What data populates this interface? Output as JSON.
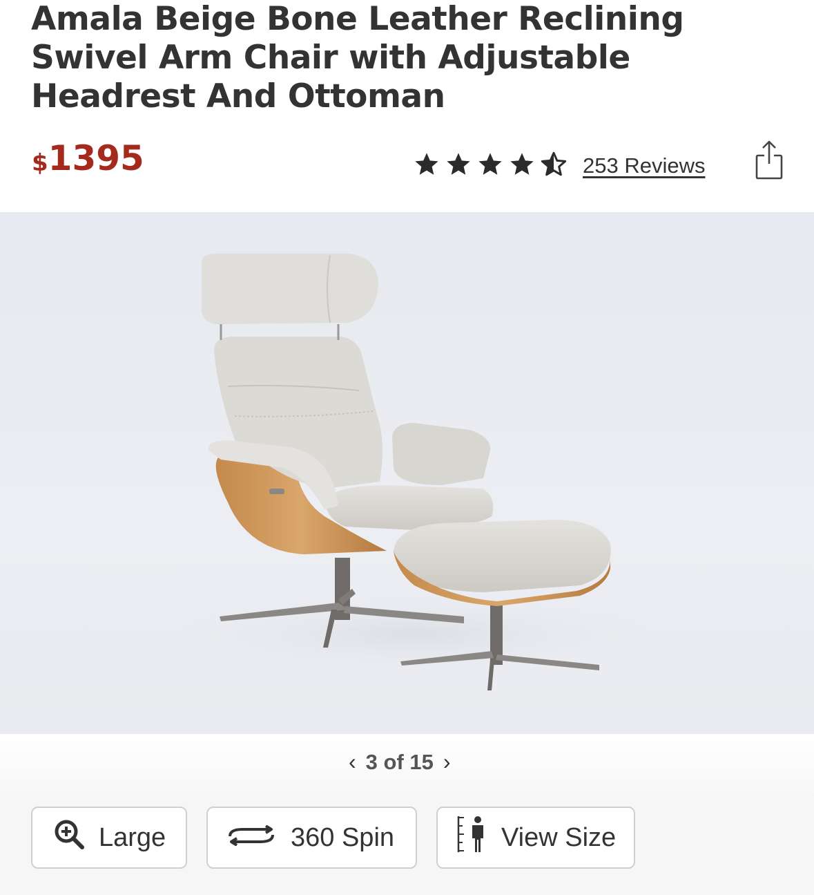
{
  "product": {
    "title": "Amala Beige Bone Leather Reclining Swivel Arm Chair with Adjustable Headrest And Ottoman",
    "price_currency": "$",
    "price_amount": "1395",
    "rating": 4.5,
    "rating_max": 5,
    "reviews_label": "253 Reviews"
  },
  "gallery": {
    "counter": "3 of 15"
  },
  "actions": {
    "large_label": "Large",
    "spin_label": "360 Spin",
    "view_size_label": "View Size"
  },
  "colors": {
    "price": "#a52a1e",
    "text": "#333333"
  }
}
